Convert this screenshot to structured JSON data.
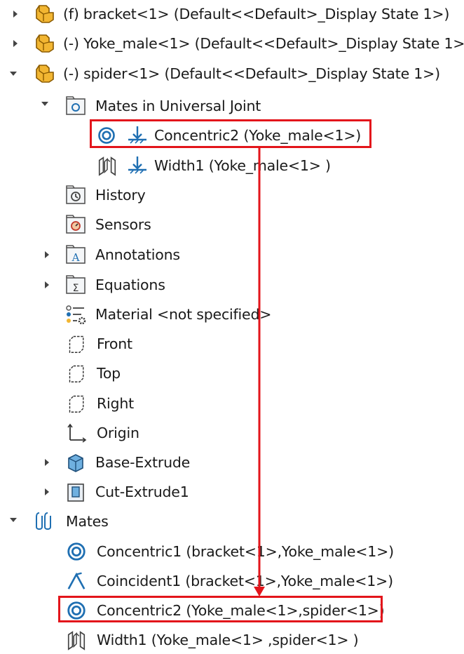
{
  "tree": {
    "components": [
      {
        "label": "(f) bracket<1> (Default<<Default>_Display State 1>)",
        "icon": "part-icon"
      },
      {
        "label": "(-) Yoke_male<1> (Default<<Default>_Display State 1>)",
        "icon": "part-icon"
      },
      {
        "label": "(-) spider<1> (Default<<Default>_Display State 1>)",
        "icon": "part-icon"
      }
    ],
    "spider_children": {
      "mates_folder": "Mates in Universal Joint",
      "mates": [
        {
          "label": "Concentric2 (Yoke_male<1>)",
          "icon": "concentric-icon"
        },
        {
          "label": "Width1 (Yoke_male<1> )",
          "icon": "width-icon"
        }
      ],
      "history": "History",
      "sensors": "Sensors",
      "annotations": "Annotations",
      "equations": "Equations",
      "material": "Material <not specified>",
      "front": "Front",
      "top": "Top",
      "right": "Right",
      "origin": "Origin",
      "base_extrude": "Base-Extrude",
      "cut_extrude": "Cut-Extrude1"
    },
    "mates_root": "Mates",
    "assembly_mates": [
      {
        "label": "Concentric1 (bracket<1>,Yoke_male<1>)",
        "icon": "concentric-icon"
      },
      {
        "label": "Coincident1 (bracket<1>,Yoke_male<1>)",
        "icon": "coincident-icon"
      },
      {
        "label": "Concentric2 (Yoke_male<1>,spider<1>)",
        "icon": "concentric-icon"
      },
      {
        "label": "Width1 (Yoke_male<1> ,spider<1> )",
        "icon": "width-icon"
      }
    ]
  },
  "colors": {
    "highlight": "#e3151b",
    "icon_blue": "#1f6fb2",
    "part_yellow": "#f2b632"
  }
}
